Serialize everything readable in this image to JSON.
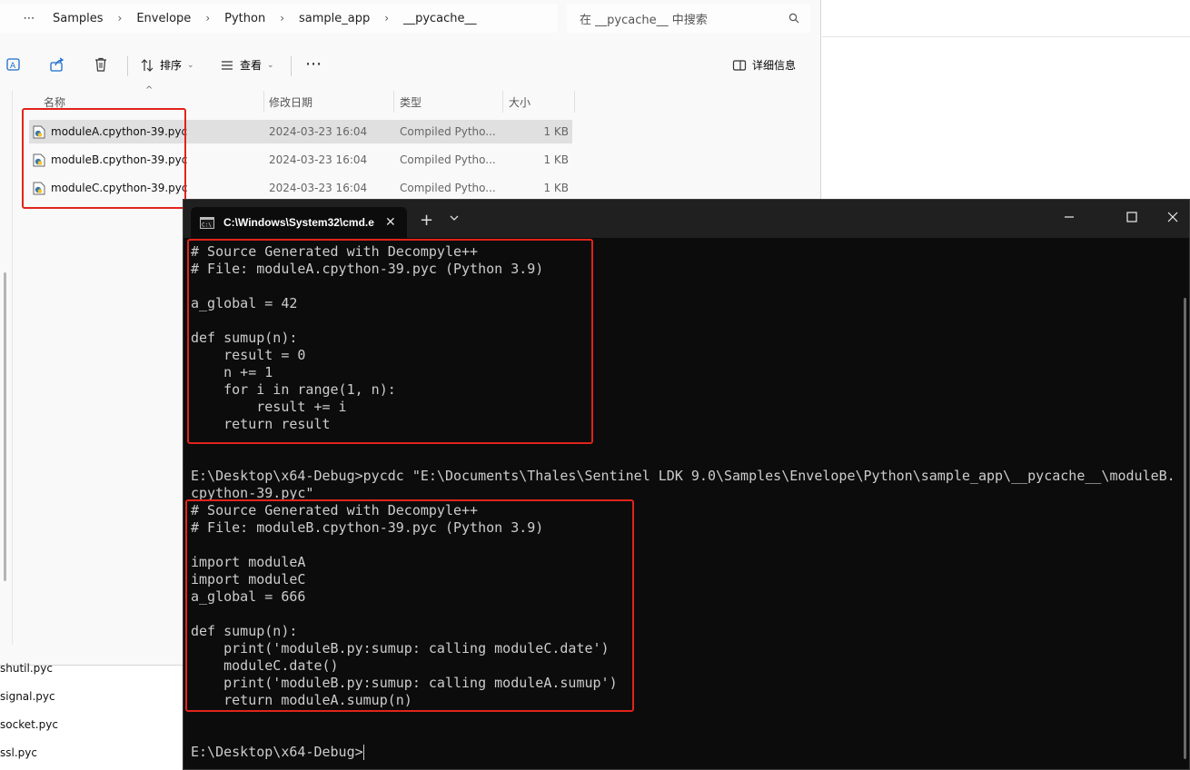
{
  "explorer": {
    "breadcrumb": [
      "Samples",
      "Envelope",
      "Python",
      "sample_app",
      "__pycache__"
    ],
    "search_placeholder": "在 __pycache__ 中搜索",
    "toolbar": {
      "sort_label": "排序",
      "view_label": "查看",
      "details_label": "详细信息"
    },
    "columns": {
      "name": "名称",
      "date": "修改日期",
      "type": "类型",
      "size": "大小"
    },
    "files": [
      {
        "name": "moduleA.cpython-39.pyc",
        "date": "2024-03-23 16:04",
        "type": "Compiled Pytho...",
        "size": "1 KB"
      },
      {
        "name": "moduleB.cpython-39.pyc",
        "date": "2024-03-23 16:04",
        "type": "Compiled Pytho...",
        "size": "1 KB"
      },
      {
        "name": "moduleC.cpython-39.pyc",
        "date": "2024-03-23 16:04",
        "type": "Compiled Pytho...",
        "size": "1 KB"
      }
    ],
    "background_files": [
      "shutil.pyc",
      "signal.pyc",
      "socket.pyc",
      "ssl.pyc"
    ]
  },
  "terminal": {
    "tab_title": "C:\\Windows\\System32\\cmd.e",
    "lines": [
      "# Source Generated with Decompyle++",
      "# File: moduleA.cpython-39.pyc (Python 3.9)",
      "",
      "a_global = 42",
      "",
      "def sumup(n):",
      "    result = 0",
      "    n += 1",
      "    for i in range(1, n):",
      "        result += i",
      "    return result",
      "",
      "",
      "E:\\Desktop\\x64-Debug>pycdc \"E:\\Documents\\Thales\\Sentinel LDK 9.0\\Samples\\Envelope\\Python\\sample_app\\__pycache__\\moduleB.",
      "cpython-39.pyc\"",
      "# Source Generated with Decompyle++",
      "# File: moduleB.cpython-39.pyc (Python 3.9)",
      "",
      "import moduleA",
      "import moduleC",
      "a_global = 666",
      "",
      "def sumup(n):",
      "    print('moduleB.py:sumup: calling moduleC.date')",
      "    moduleC.date()",
      "    print('moduleB.py:sumup: calling moduleA.sumup')",
      "    return moduleA.sumup(n)",
      "",
      "",
      "E:\\Desktop\\x64-Debug>"
    ]
  }
}
